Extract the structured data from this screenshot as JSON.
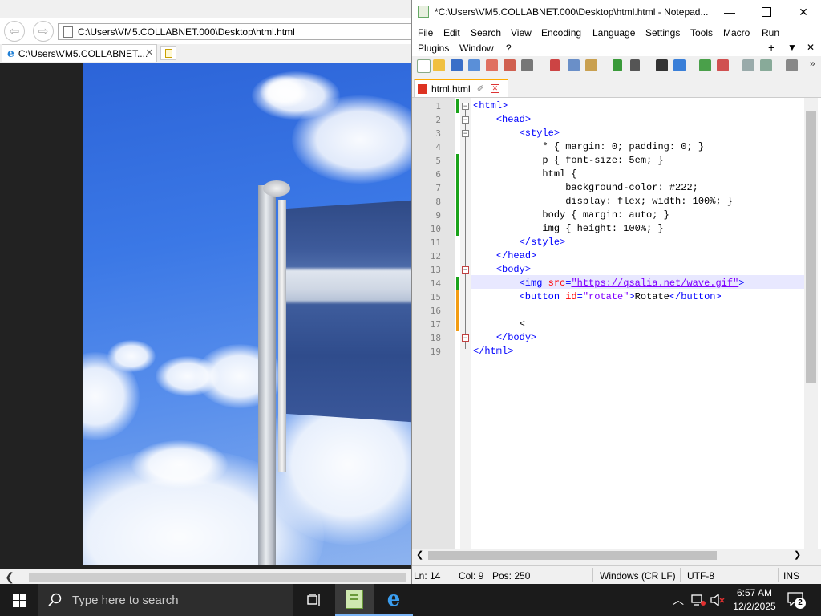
{
  "ie": {
    "address": "C:\\Users\\VM5.COLLABNET.000\\Desktop\\html.html",
    "tab_title": "C:\\Users\\VM5.COLLABNET....",
    "tab_close": "✕"
  },
  "npp": {
    "title": "*C:\\Users\\VM5.COLLABNET.000\\Desktop\\html.html - Notepad...",
    "menu_row1": [
      "File",
      "Edit",
      "Search",
      "View",
      "Encoding",
      "Language",
      "Settings",
      "Tools",
      "Macro",
      "Run"
    ],
    "menu_row2": [
      "Plugins",
      "Window",
      "?"
    ],
    "menu_extra": [
      "+",
      "▼",
      "✕"
    ],
    "tab_name": "html.html",
    "line_numbers": [
      "1",
      "2",
      "3",
      "4",
      "5",
      "6",
      "7",
      "8",
      "9",
      "10",
      "11",
      "12",
      "13",
      "14",
      "15",
      "16",
      "17",
      "18",
      "19"
    ],
    "code_lines": [
      [
        {
          "t": "<html>",
          "c": "tag"
        }
      ],
      [
        {
          "t": "    "
        },
        {
          "t": "<head>",
          "c": "tag"
        }
      ],
      [
        {
          "t": "        "
        },
        {
          "t": "<style>",
          "c": "tag"
        }
      ],
      [
        {
          "t": "            * { margin: 0; padding: 0; }"
        }
      ],
      [
        {
          "t": "            p { font-size: 5em; }"
        }
      ],
      [
        {
          "t": "            html {"
        }
      ],
      [
        {
          "t": "                background-color: #222;"
        }
      ],
      [
        {
          "t": "                display: flex; width: 100%; }"
        }
      ],
      [
        {
          "t": "            body { margin: auto; }"
        }
      ],
      [
        {
          "t": "            img { height: 100%; }"
        }
      ],
      [
        {
          "t": "        "
        },
        {
          "t": "</style>",
          "c": "tag"
        }
      ],
      [
        {
          "t": "    "
        },
        {
          "t": "</head>",
          "c": "tag"
        }
      ],
      [
        {
          "t": "    "
        },
        {
          "t": "<body>",
          "c": "tag"
        }
      ],
      [
        {
          "t": "        "
        },
        {
          "t": "<img ",
          "c": "tag"
        },
        {
          "t": "src",
          "c": "attr"
        },
        {
          "t": "=",
          "c": "tag"
        },
        {
          "t": "\"https://qsalia.net/wave.gif\"",
          "c": "str"
        },
        {
          "t": ">",
          "c": "tag"
        }
      ],
      [
        {
          "t": "        "
        },
        {
          "t": "<button ",
          "c": "tag"
        },
        {
          "t": "id",
          "c": "attr"
        },
        {
          "t": "=",
          "c": "tag"
        },
        {
          "t": "\"rotate\"",
          "c": "val"
        },
        {
          "t": ">",
          "c": "tag"
        },
        {
          "t": "Rotate"
        },
        {
          "t": "</button>",
          "c": "tag"
        }
      ],
      [
        {
          "t": ""
        }
      ],
      [
        {
          "t": "        <"
        }
      ],
      [
        {
          "t": "    "
        },
        {
          "t": "</body>",
          "c": "tag"
        }
      ],
      [
        {
          "t": "</html>",
          "c": "tag"
        }
      ]
    ],
    "status": {
      "ln": "Ln: 14",
      "col": "Col: 9",
      "pos": "Pos: 250",
      "eol": "Windows (CR LF)",
      "enc": "UTF-8",
      "ins": "INS"
    }
  },
  "taskbar": {
    "search_placeholder": "Type here to search",
    "time": "6:57 AM",
    "date": "12/2/2025",
    "notif_count": "2"
  },
  "colors": {
    "taskbar": "#1b1b1b",
    "tag": "#0000ff",
    "attr": "#ff0000",
    "string": "#8000ff",
    "ie_accent": "#1f7fd6",
    "npp_tab_accent": "#ffaa00"
  }
}
